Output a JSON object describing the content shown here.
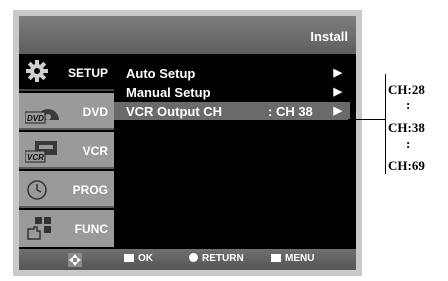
{
  "header": {
    "title": "Install"
  },
  "sidebar": {
    "items": [
      {
        "label": "SETUP",
        "icon": "gear-icon",
        "active": true
      },
      {
        "label": "DVD",
        "icon": "dvd-icon",
        "icon_text": "DVD"
      },
      {
        "label": "VCR",
        "icon": "vcr-icon",
        "icon_text": "VCR"
      },
      {
        "label": "PROG",
        "icon": "clock-icon"
      },
      {
        "label": "FUNC",
        "icon": "hand-icon"
      }
    ]
  },
  "menu": {
    "items": [
      {
        "label": "Auto Setup",
        "value": "",
        "arrow": "▶"
      },
      {
        "label": "Manual Setup",
        "value": "",
        "arrow": "▶"
      },
      {
        "label": "VCR Output CH",
        "value": ": CH 38",
        "arrow": "▶",
        "selected": true
      }
    ]
  },
  "footer": {
    "nav_icon": "move-arrows-icon",
    "ok_label": "OK",
    "return_label": "RETURN",
    "menu_label": "MENU"
  },
  "annotation": {
    "lines": [
      "CH:28",
      ":",
      "CH:38",
      ":",
      "CH:69"
    ]
  },
  "colors": {
    "titlebar": "#6e6e6e",
    "sidebar_inactive": "#9a9a9a",
    "selected_row": "#6a6a6a",
    "screen_bg": "#000000"
  }
}
